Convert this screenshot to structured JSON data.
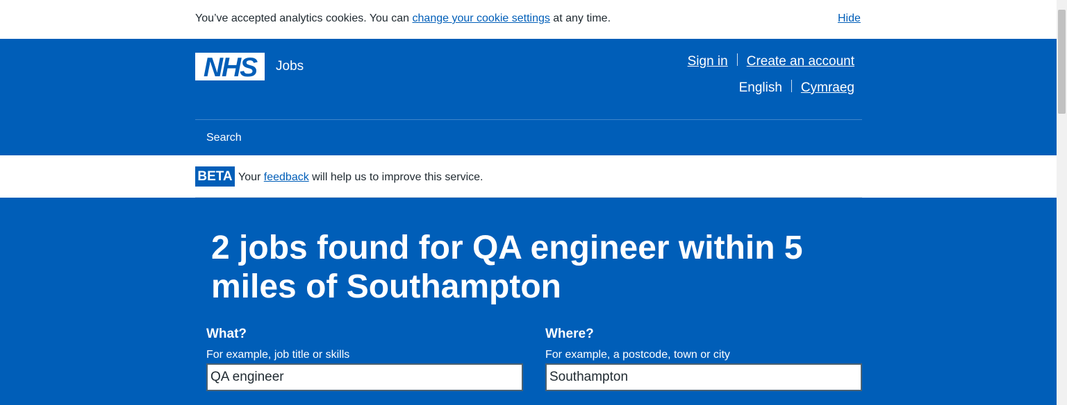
{
  "cookie_banner": {
    "text_before": "You’ve accepted analytics cookies. You can ",
    "link_text": "change your cookie settings",
    "text_after": " at any time.",
    "hide_label": "Hide"
  },
  "header": {
    "logo_text": "NHS",
    "service_name": "Jobs",
    "sign_in": "Sign in",
    "create_account": "Create an account",
    "language_current": "English",
    "language_other": "Cymraeg",
    "nav_search": "Search"
  },
  "beta_banner": {
    "tag": "BETA",
    "text_before": "Your ",
    "link_text": "feedback",
    "text_after": " will help us to improve this service."
  },
  "main": {
    "title": "2 jobs found for QA engineer within 5 miles of Southampton",
    "what": {
      "label": "What?",
      "hint": "For example, job title or skills",
      "value": "QA engineer"
    },
    "where": {
      "label": "Where?",
      "hint": "For example, a postcode, town or city",
      "value": "Southampton"
    }
  },
  "colors": {
    "nhs_blue": "#005eb8",
    "white": "#ffffff",
    "text": "#212b32"
  }
}
